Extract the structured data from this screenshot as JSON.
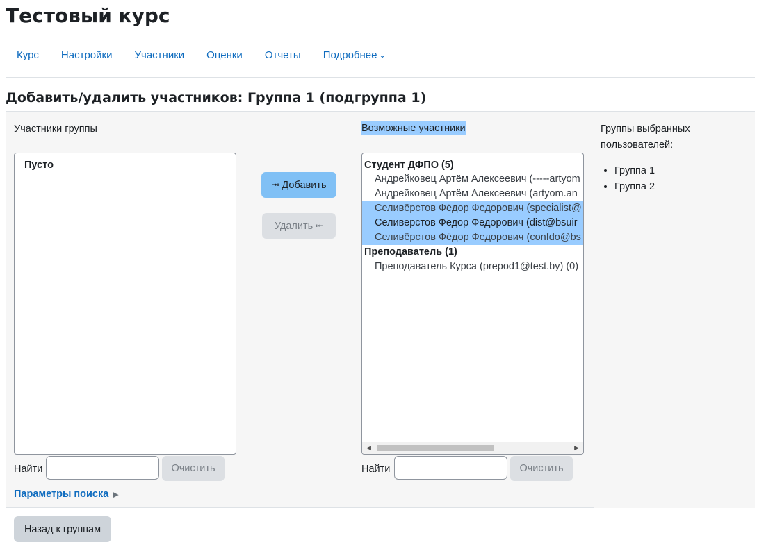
{
  "course_title": "Тестовый курс",
  "nav": {
    "items": [
      "Курс",
      "Настройки",
      "Участники",
      "Оценки",
      "Отчеты"
    ],
    "more_label": "Подробнее"
  },
  "page_heading": "Добавить/удалить участников: Группа 1 (подгруппа 1)",
  "members": {
    "label": "Участники группы",
    "empty_label": "Пусто",
    "search_label": "Найти",
    "search_value": "",
    "clear_label": "Очистить"
  },
  "actions": {
    "add_label": "⭲ Добавить",
    "remove_label": "Удалить ⭰"
  },
  "potential": {
    "label": "Возможные участники",
    "groups": [
      {
        "label": "Студент ДФПО (5)",
        "options": [
          {
            "text": "Андрейковец Артём Алексеевич (-----artyom",
            "selected": false
          },
          {
            "text": "Андрейковец Артём Алексеевич (artyom.an",
            "selected": false
          },
          {
            "text": "Селивёрстов Фёдор Федорович (specialist@",
            "selected": true
          },
          {
            "text": "Селиверстов Федор Федорович (dist@bsuir",
            "selected": true
          },
          {
            "text": "Селивёрстов Фёдор Федорович (confdo@bs",
            "selected": true
          }
        ]
      },
      {
        "label": "Преподаватель (1)",
        "options": [
          {
            "text": "Преподаватель Курса (prepod1@test.by) (0)",
            "selected": false
          }
        ]
      }
    ],
    "search_label": "Найти",
    "search_value": "",
    "clear_label": "Очистить"
  },
  "user_groups": {
    "label": "Группы выбранных пользователей:",
    "items": [
      "Группа 1",
      "Группа 2"
    ]
  },
  "search_params_label": "Параметры поиска",
  "back_label": "Назад к группам",
  "colors": {
    "link": "#0f6cbf",
    "selection": "#99ccff",
    "primary_button": "#80c0f5"
  }
}
